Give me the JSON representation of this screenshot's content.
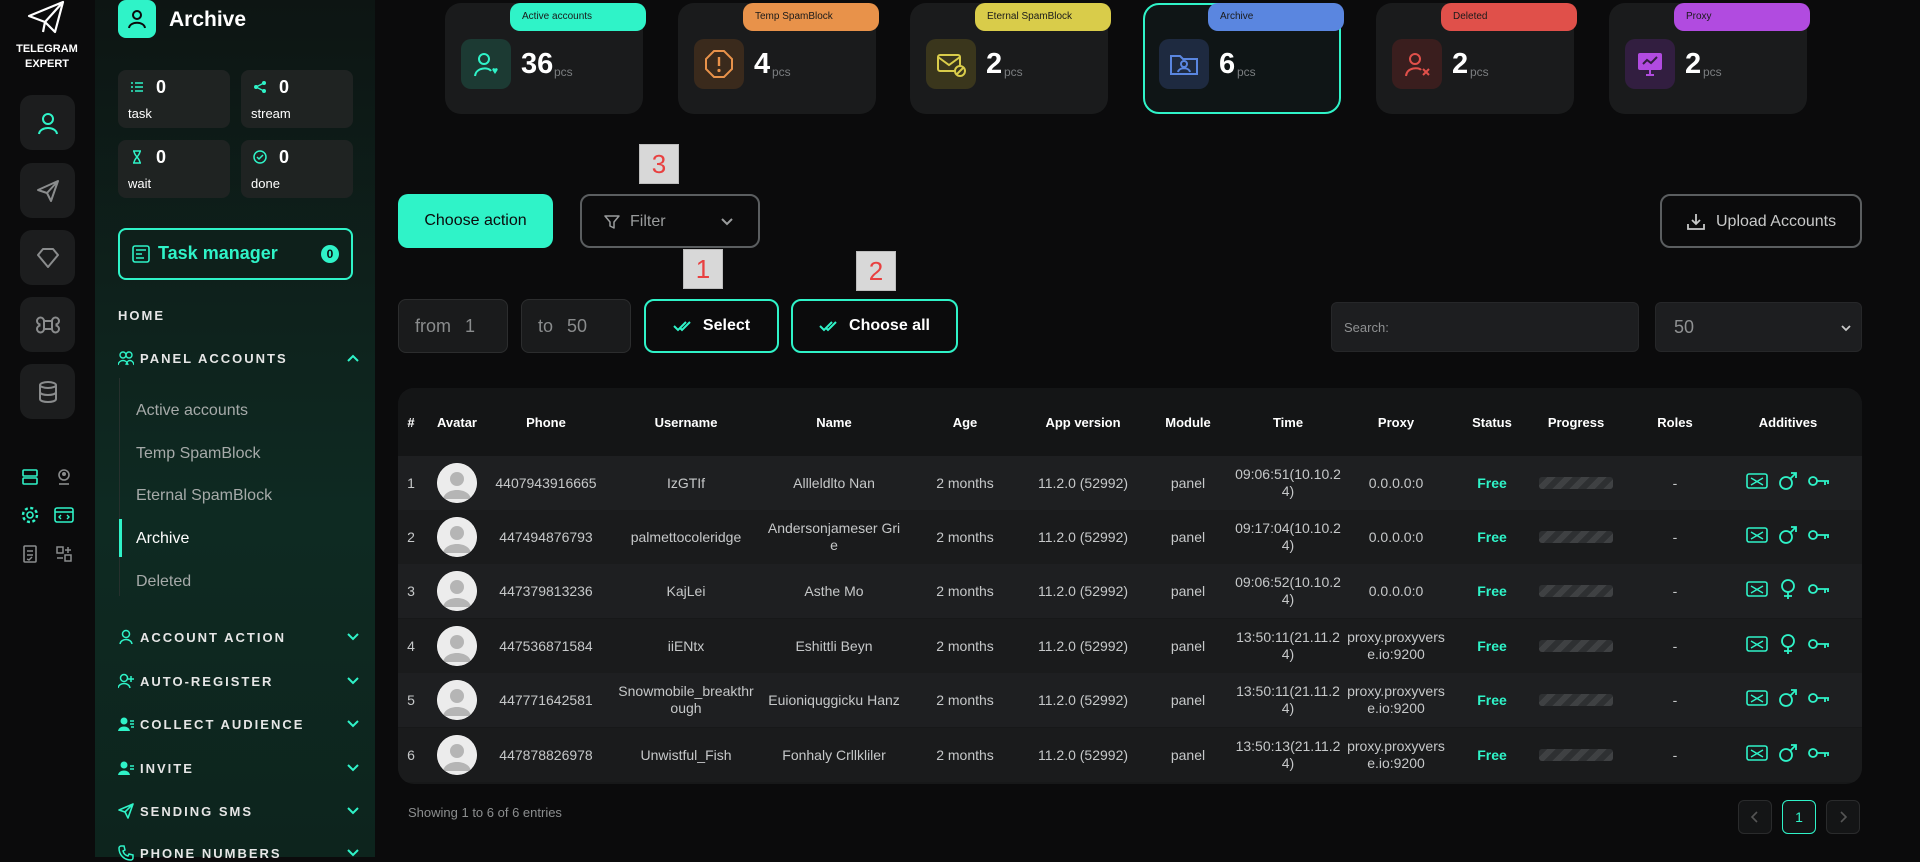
{
  "brand": {
    "line1": "TELEGRAM",
    "line2": "EXPERT"
  },
  "sidebar": {
    "title": "Archive",
    "stats": [
      {
        "value": "0",
        "label": "task"
      },
      {
        "value": "0",
        "label": "stream"
      },
      {
        "value": "0",
        "label": "wait"
      },
      {
        "value": "0",
        "label": "done"
      }
    ],
    "task_manager": {
      "label": "Task manager",
      "count": "0"
    },
    "home": "HOME",
    "panel_accounts": "PANEL ACCOUNTS",
    "sub_items": [
      "Active accounts",
      "Temp SpamBlock",
      "Eternal SpamBlock",
      "Archive",
      "Deleted"
    ],
    "sections": [
      "ACCOUNT ACTION",
      "AUTO-REGISTER",
      "COLLECT AUDIENCE",
      "INVITE",
      "SENDING SMS",
      "PHONE NUMBERS"
    ]
  },
  "top_cards": [
    {
      "label": "Active accounts",
      "value": "36",
      "unit": "pcs",
      "color": "#2ff3c8"
    },
    {
      "label": "Temp SpamBlock",
      "value": "4",
      "unit": "pcs",
      "color": "#e8924a"
    },
    {
      "label": "Eternal SpamBlock",
      "value": "2",
      "unit": "pcs",
      "color": "#d9cc4a"
    },
    {
      "label": "Archive",
      "value": "6",
      "unit": "pcs",
      "color": "#5a86e0"
    },
    {
      "label": "Deleted",
      "value": "2",
      "unit": "pcs",
      "color": "#e0504a"
    },
    {
      "label": "Proxy",
      "value": "2",
      "unit": "pcs",
      "color": "#b14be0"
    }
  ],
  "controls": {
    "choose_action": "Choose action",
    "filter": "Filter",
    "upload": "Upload Accounts",
    "from_label": "from",
    "from_value": "1",
    "to_label": "to",
    "to_value": "50",
    "select": "Select",
    "choose_all": "Choose all",
    "search_placeholder": "Search:",
    "per_page": "50"
  },
  "badges": [
    "1",
    "2",
    "3"
  ],
  "table": {
    "headers": [
      "#",
      "Avatar",
      "Phone",
      "Username",
      "Name",
      "Age",
      "App version",
      "Module",
      "Time",
      "Proxy",
      "Status",
      "Progress",
      "Roles",
      "Additives"
    ],
    "rows": [
      {
        "n": "1",
        "phone": "4407943916665",
        "username": "IzGTIf",
        "name": "Allleldlto Nan",
        "age": "2 months",
        "app": "11.2.0 (52992)",
        "module": "panel",
        "time": "09:06:51(10.10.24)",
        "proxy": "0.0.0.0:0",
        "status": "Free",
        "roles": "-",
        "gender": "male"
      },
      {
        "n": "2",
        "phone": "447494876793",
        "username": "palmettocoleridge",
        "name": "Andersonjameser Grie",
        "age": "2 months",
        "app": "11.2.0 (52992)",
        "module": "panel",
        "time": "09:17:04(10.10.24)",
        "proxy": "0.0.0.0:0",
        "status": "Free",
        "roles": "-",
        "gender": "male"
      },
      {
        "n": "3",
        "phone": "447379813236",
        "username": "KajLei",
        "name": "Asthe Mo",
        "age": "2 months",
        "app": "11.2.0 (52992)",
        "module": "panel",
        "time": "09:06:52(10.10.24)",
        "proxy": "0.0.0.0:0",
        "status": "Free",
        "roles": "-",
        "gender": "female"
      },
      {
        "n": "4",
        "phone": "447536871584",
        "username": "iiENtx",
        "name": "Eshittli Beyn",
        "age": "2 months",
        "app": "11.2.0 (52992)",
        "module": "panel",
        "time": "13:50:11(21.11.24)",
        "proxy": "proxy.proxyverse.io:9200",
        "status": "Free",
        "roles": "-",
        "gender": "female"
      },
      {
        "n": "5",
        "phone": "447771642581",
        "username": "Snowmobile_breakthrough",
        "name": "Euioniquggicku Hanz",
        "age": "2 months",
        "app": "11.2.0 (52992)",
        "module": "panel",
        "time": "13:50:11(21.11.24)",
        "proxy": "proxy.proxyverse.io:9200",
        "status": "Free",
        "roles": "-",
        "gender": "male"
      },
      {
        "n": "6",
        "phone": "447878826978",
        "username": "Unwistful_Fish",
        "name": "Fonhaly Crllkliler",
        "age": "2 months",
        "app": "11.2.0 (52992)",
        "module": "panel",
        "time": "13:50:13(21.11.24)",
        "proxy": "proxy.proxyverse.io:9200",
        "status": "Free",
        "roles": "-",
        "gender": "male"
      }
    ]
  },
  "footer": {
    "showing": "Showing 1 to 6 of 6 entries",
    "page": "1"
  }
}
